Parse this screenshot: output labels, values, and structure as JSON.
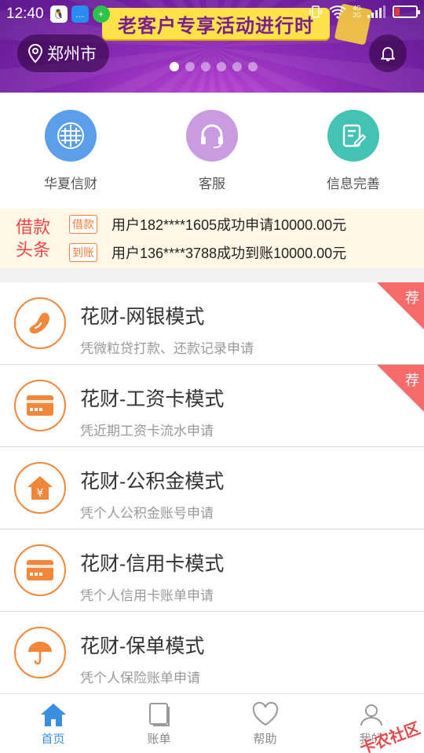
{
  "status_bar": {
    "time": "12:40",
    "net_top": "4G",
    "net_bottom": "2G"
  },
  "banner": {
    "promo_text": "老客户专享活动进行时",
    "city": "郑州市",
    "slide_count": 6,
    "active_slide": 0
  },
  "quick_actions": [
    {
      "label": "华夏信财",
      "icon": "huaxia-logo-icon",
      "color": "#5b9ee9"
    },
    {
      "label": "客服",
      "icon": "headset-icon",
      "color": "#c99be0"
    },
    {
      "label": "信息完善",
      "icon": "edit-note-icon",
      "color": "#42c3b4"
    }
  ],
  "ticker": {
    "title_line1": "借款",
    "title_line2": "头条",
    "rows": [
      {
        "badge": "借款",
        "text": "用户182****1605成功申请10000.00元"
      },
      {
        "badge": "到账",
        "text": "用户136****3788成功到账10000.00元"
      }
    ]
  },
  "products": [
    {
      "title": "花财-网银模式",
      "subtitle": "凭微粒贷打款、还款记录申请",
      "icon": "bean-icon",
      "recommended": true,
      "tag": "荐"
    },
    {
      "title": "花财-工资卡模式",
      "subtitle": "凭近期工资卡流水申请",
      "icon": "card-icon",
      "recommended": true,
      "tag": "荐"
    },
    {
      "title": "花财-公积金模式",
      "subtitle": "凭个人公积金账号申请",
      "icon": "house-yuan-icon",
      "recommended": false
    },
    {
      "title": "花财-信用卡模式",
      "subtitle": "凭个人信用卡账单申请",
      "icon": "card-icon",
      "recommended": false
    },
    {
      "title": "花财-保单模式",
      "subtitle": "凭个人保险账单申请",
      "icon": "umbrella-icon",
      "recommended": false
    }
  ],
  "bottom_nav": [
    {
      "label": "首页",
      "icon": "home-icon",
      "active": true
    },
    {
      "label": "账单",
      "icon": "bill-icon",
      "active": false
    },
    {
      "label": "帮助",
      "icon": "heart-icon",
      "active": false
    },
    {
      "label": "我的",
      "icon": "user-icon",
      "active": false
    }
  ],
  "watermark": "卡农社区",
  "colors": {
    "accent": "#f0873a",
    "active_nav": "#3b8fe0",
    "ticker_title": "#f2464a",
    "recommend_corner": "#f76b6b"
  }
}
